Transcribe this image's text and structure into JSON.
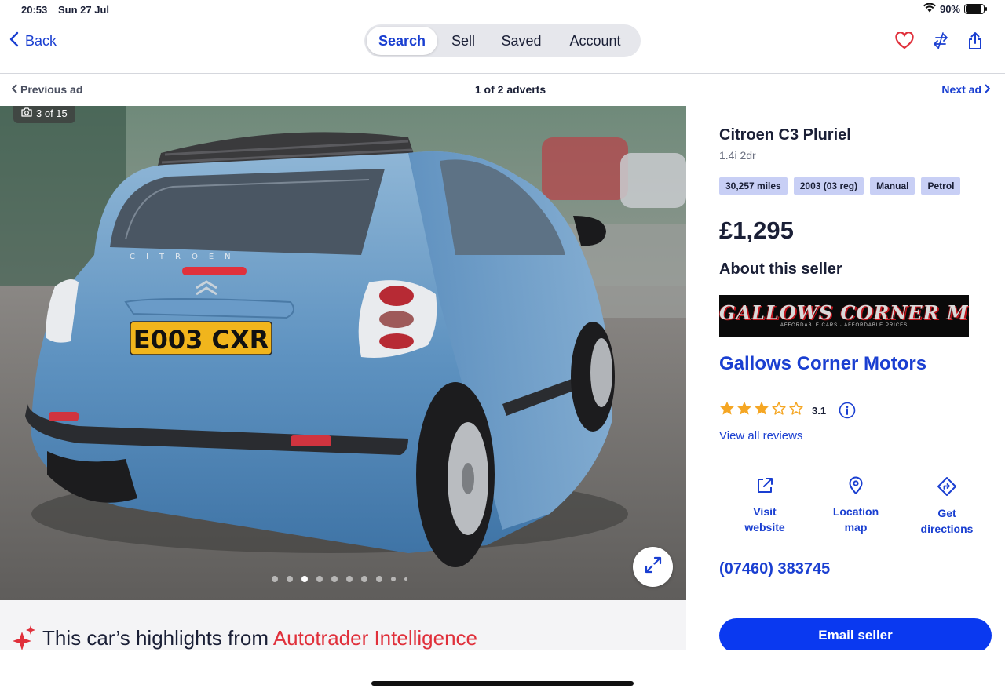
{
  "status_bar": {
    "time": "20:53",
    "date": "Sun 27 Jul",
    "battery": "90%"
  },
  "nav": {
    "back_label": "Back",
    "tabs": [
      {
        "label": "Search",
        "active": true
      },
      {
        "label": "Sell",
        "active": false
      },
      {
        "label": "Saved",
        "active": false
      },
      {
        "label": "Account",
        "active": false
      }
    ],
    "icons": [
      "heart-icon",
      "compare-icon",
      "share-icon"
    ]
  },
  "ad_nav": {
    "previous": "Previous ad",
    "count": "1 of 2 adverts",
    "next": "Next ad"
  },
  "gallery": {
    "photo_count": "3 of 15",
    "plate_text": "E003 CXR",
    "badge_text": "CITROEN",
    "dot_count": 10,
    "active_dot": 2
  },
  "highlights": {
    "prefix": "This car’s highlights from ",
    "accent": "Autotrader Intelligence"
  },
  "listing": {
    "title": "Citroen C3 Pluriel",
    "subtitle": "1.4i 2dr",
    "tags": [
      "30,257 miles",
      "2003 (03 reg)",
      "Manual",
      "Petrol"
    ],
    "price": "£1,295"
  },
  "seller": {
    "heading": "About this seller",
    "logo_text": "GALLOWS CORNER MOTORS",
    "logo_tagline": "AFFORDABLE CARS · AFFORDABLE PRICES",
    "name": "Gallows Corner Motors",
    "rating_value": "3.1",
    "rating_stars": 3,
    "reviews_link": "View all reviews",
    "actions": [
      {
        "icon": "external-link-icon",
        "label": "Visit website"
      },
      {
        "icon": "location-pin-icon",
        "label": "Location map"
      },
      {
        "icon": "directions-icon",
        "label": "Get directions"
      }
    ],
    "phone": "(07460) 383745",
    "email_button": "Email seller"
  },
  "colors": {
    "accent_blue": "#1a3fd1",
    "button_blue": "#0a39f0",
    "highlight_red": "#e0303b",
    "tag_bg": "#c8cff5",
    "star": "#f5a623"
  }
}
